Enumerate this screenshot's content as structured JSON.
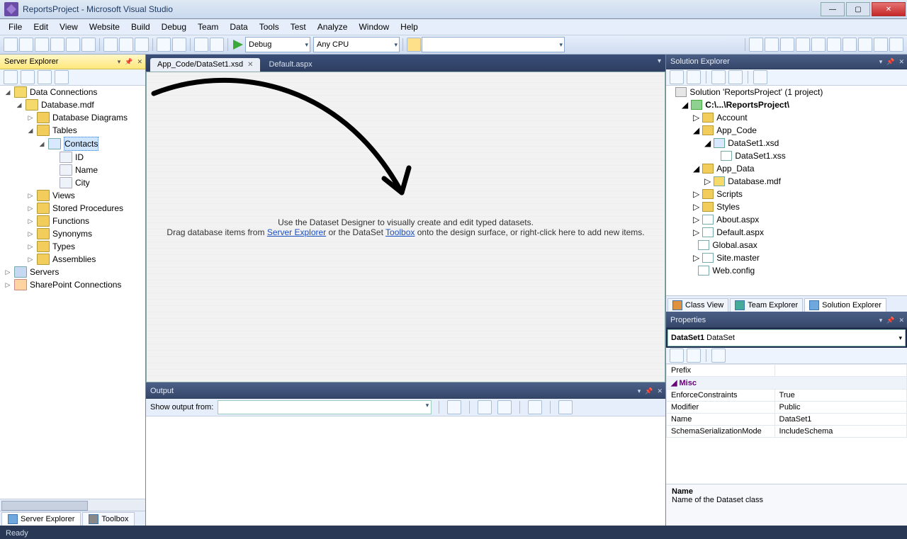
{
  "title": "ReportsProject - Microsoft Visual Studio",
  "menu": [
    "File",
    "Edit",
    "View",
    "Website",
    "Build",
    "Debug",
    "Team",
    "Data",
    "Tools",
    "Test",
    "Analyze",
    "Window",
    "Help"
  ],
  "toolbar": {
    "config": "Debug",
    "platform": "Any CPU"
  },
  "serverExplorer": {
    "title": "Server Explorer",
    "tree": {
      "dataConnections": "Data Connections",
      "database": "Database.mdf",
      "diagrams": "Database Diagrams",
      "tables": "Tables",
      "contacts": "Contacts",
      "cols": [
        "ID",
        "Name",
        "City"
      ],
      "views": "Views",
      "sprocs": "Stored Procedures",
      "functions": "Functions",
      "synonyms": "Synonyms",
      "types": "Types",
      "assemblies": "Assemblies",
      "servers": "Servers",
      "sharepoint": "SharePoint Connections"
    },
    "bottomTabs": {
      "serverExplorer": "Server Explorer",
      "toolbox": "Toolbox"
    }
  },
  "documents": {
    "active": "App_Code/DataSet1.xsd",
    "inactive": "Default.aspx",
    "designerMsg1": "Use the Dataset Designer to visually create and edit typed datasets.",
    "designerMsg2a": "Drag database items from ",
    "designerLink1": "Server Explorer",
    "designerMsg2b": " or the DataSet ",
    "designerLink2": "Toolbox",
    "designerMsg2c": " onto the design surface, or right-click here to add new items."
  },
  "output": {
    "title": "Output",
    "label": "Show output from:"
  },
  "solutionExplorer": {
    "title": "Solution Explorer",
    "solution": "Solution 'ReportsProject' (1 project)",
    "project": "C:\\...\\ReportsProject\\",
    "items": {
      "account": "Account",
      "appcode": "App_Code",
      "dataset1": "DataSet1.xsd",
      "dataset1xss": "DataSet1.xss",
      "appdata": "App_Data",
      "databasemdf": "Database.mdf",
      "scripts": "Scripts",
      "styles": "Styles",
      "about": "About.aspx",
      "default": "Default.aspx",
      "global": "Global.asax",
      "site": "Site.master",
      "web": "Web.config"
    },
    "tabs": {
      "classView": "Class View",
      "teamExplorer": "Team Explorer",
      "solutionExplorer": "Solution Explorer"
    }
  },
  "properties": {
    "title": "Properties",
    "object": "DataSet1 DataSet",
    "objectName": "DataSet1",
    "objectType": "DataSet",
    "rows": [
      {
        "name": "Prefix",
        "value": ""
      },
      {
        "cat": "Misc"
      },
      {
        "name": "EnforceConstraints",
        "value": "True"
      },
      {
        "name": "Modifier",
        "value": "Public"
      },
      {
        "name": "Name",
        "value": "DataSet1"
      },
      {
        "name": "SchemaSerializationMode",
        "value": "IncludeSchema"
      }
    ],
    "descTitle": "Name",
    "descText": "Name of the Dataset class"
  },
  "status": "Ready"
}
